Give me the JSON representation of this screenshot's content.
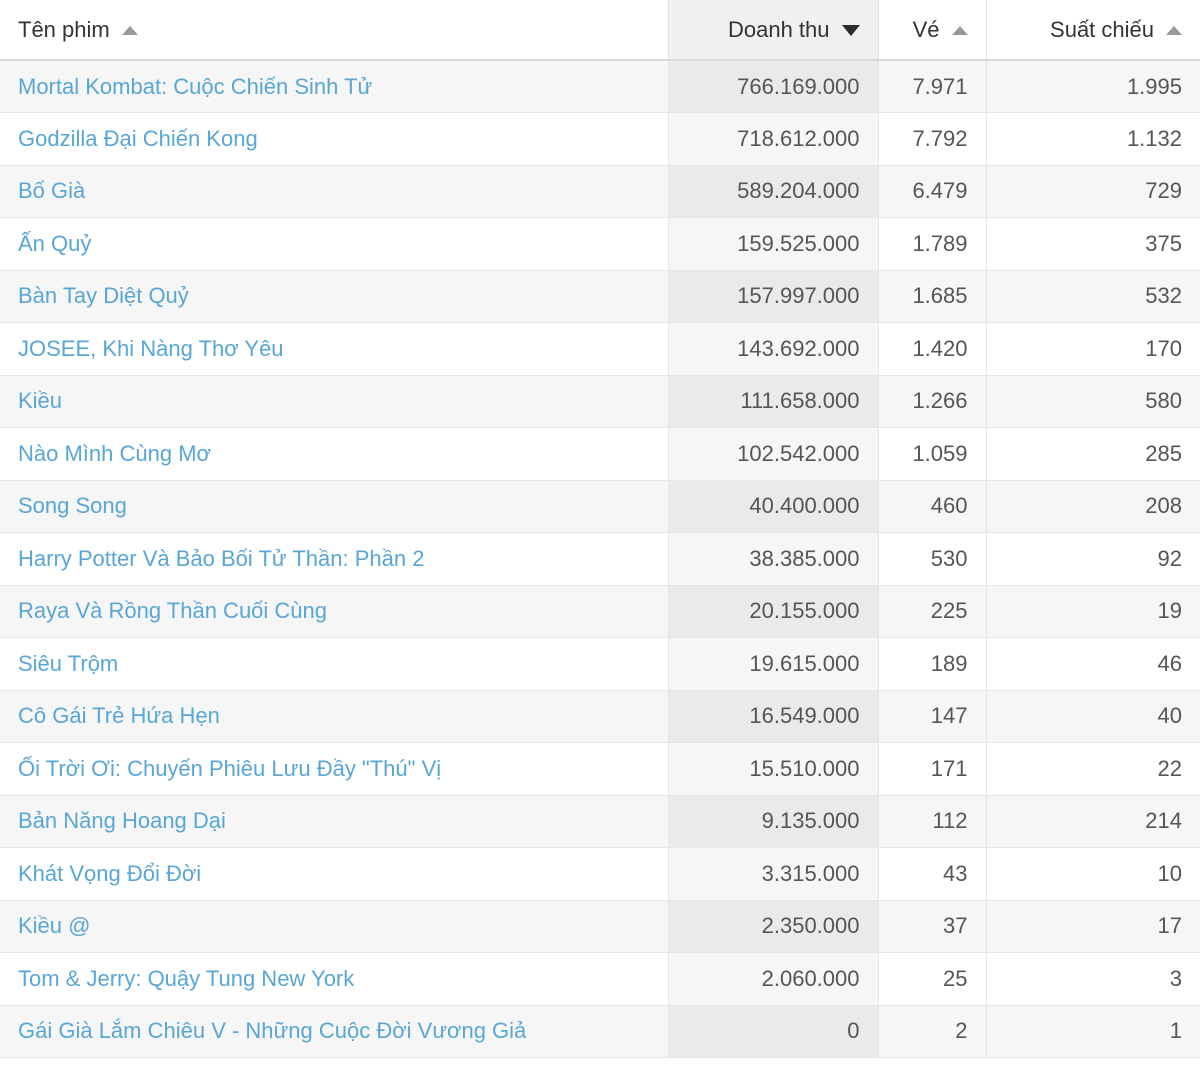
{
  "table": {
    "columns": [
      {
        "key": "name",
        "label": "Tên phim",
        "align": "left",
        "sort": "asc",
        "active": false
      },
      {
        "key": "revenue",
        "label": "Doanh thu",
        "align": "right",
        "sort": "desc",
        "active": true
      },
      {
        "key": "tickets",
        "label": "Vé",
        "align": "right",
        "sort": "asc",
        "active": false
      },
      {
        "key": "shows",
        "label": "Suất chiếu",
        "align": "right",
        "sort": "asc",
        "active": false
      }
    ],
    "sort_icons": {
      "asc": "caret-up-icon",
      "desc": "caret-down-icon"
    },
    "colors": {
      "link": "#58a6d6",
      "text": "#555555",
      "header_text": "#333333",
      "stripe": "#f6f6f6",
      "sorted_column": "#eaeaea",
      "header_sorted": "#f0f0f0",
      "border": "#e6e6e6"
    },
    "rows": [
      {
        "name": "Mortal Kombat: Cuộc Chiến Sinh Tử",
        "revenue": "766.169.000",
        "tickets": "7.971",
        "shows": "1.995"
      },
      {
        "name": "Godzilla Đại Chiến Kong",
        "revenue": "718.612.000",
        "tickets": "7.792",
        "shows": "1.132"
      },
      {
        "name": "Bố Già",
        "revenue": "589.204.000",
        "tickets": "6.479",
        "shows": "729"
      },
      {
        "name": "Ấn Quỷ",
        "revenue": "159.525.000",
        "tickets": "1.789",
        "shows": "375"
      },
      {
        "name": "Bàn Tay Diệt Quỷ",
        "revenue": "157.997.000",
        "tickets": "1.685",
        "shows": "532"
      },
      {
        "name": "JOSEE, Khi Nàng Thơ Yêu",
        "revenue": "143.692.000",
        "tickets": "1.420",
        "shows": "170"
      },
      {
        "name": "Kiều",
        "revenue": "111.658.000",
        "tickets": "1.266",
        "shows": "580"
      },
      {
        "name": "Nào Mình Cùng Mơ",
        "revenue": "102.542.000",
        "tickets": "1.059",
        "shows": "285"
      },
      {
        "name": "Song Song",
        "revenue": "40.400.000",
        "tickets": "460",
        "shows": "208"
      },
      {
        "name": "Harry Potter Và Bảo Bối Tử Thần: Phần 2",
        "revenue": "38.385.000",
        "tickets": "530",
        "shows": "92"
      },
      {
        "name": "Raya Và Rồng Thần Cuối Cùng",
        "revenue": "20.155.000",
        "tickets": "225",
        "shows": "19"
      },
      {
        "name": "Siêu Trộm",
        "revenue": "19.615.000",
        "tickets": "189",
        "shows": "46"
      },
      {
        "name": "Cô Gái Trẻ Hứa Hẹn",
        "revenue": "16.549.000",
        "tickets": "147",
        "shows": "40"
      },
      {
        "name": "Ối Trời Ơi: Chuyến Phiêu Lưu Đầy \"Thú\" Vị",
        "revenue": "15.510.000",
        "tickets": "171",
        "shows": "22"
      },
      {
        "name": "Bản Năng Hoang Dại",
        "revenue": "9.135.000",
        "tickets": "112",
        "shows": "214"
      },
      {
        "name": "Khát Vọng Đổi Đời",
        "revenue": "3.315.000",
        "tickets": "43",
        "shows": "10"
      },
      {
        "name": "Kiều @",
        "revenue": "2.350.000",
        "tickets": "37",
        "shows": "17"
      },
      {
        "name": "Tom & Jerry: Quậy Tung New York",
        "revenue": "2.060.000",
        "tickets": "25",
        "shows": "3"
      },
      {
        "name": "Gái Già Lắm Chiêu V - Những Cuộc Đời Vương Giả",
        "revenue": "0",
        "tickets": "2",
        "shows": "1"
      }
    ]
  }
}
